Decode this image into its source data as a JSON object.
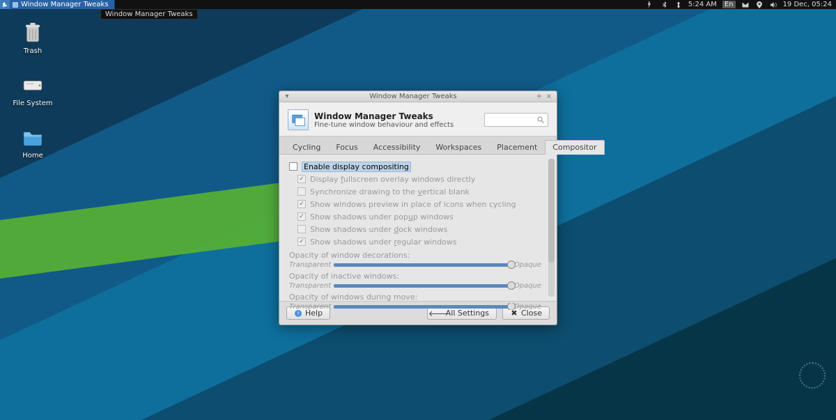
{
  "panel": {
    "task_label": "Window Manager Tweaks",
    "tooltip": "Window Manager Tweaks",
    "time": "5:24 AM",
    "lang": "En",
    "date": "19 Dec, 05:24"
  },
  "desktop": {
    "trash": "Trash",
    "filesystem": "File System",
    "home": "Home"
  },
  "dialog": {
    "title": "Window Manager Tweaks",
    "header_title": "Window Manager Tweaks",
    "header_subtitle": "Fine-tune window behaviour and effects",
    "tabs": [
      "Cycling",
      "Focus",
      "Accessibility",
      "Workspaces",
      "Placement",
      "Compositor"
    ],
    "opts": {
      "enable": "Enable display compositing",
      "full_pre": "Display ",
      "full_u": "f",
      "full_post": "ullscreen overlay windows directly",
      "sync_pre": "Synchronize drawing to the ",
      "sync_u": "v",
      "sync_post": "ertical blank",
      "prev": "Show windows preview in place of icons when cycling",
      "popup_pre": "Show shadows under pop",
      "popup_u": "u",
      "popup_post": "p windows",
      "dock_pre": "Show shadows under ",
      "dock_u": "d",
      "dock_post": "ock windows",
      "regular_pre": "Show shadows under ",
      "regular_u": "r",
      "regular_post": "egular windows"
    },
    "sections": {
      "deco": "Opacity of window decorations:",
      "inactive_pre": "Opacity of ",
      "inactive_u": "i",
      "inactive_post": "nactive windows:",
      "move": "Opacity of windows during move:"
    },
    "slider": {
      "min": "Transparent",
      "max": "Opaque"
    },
    "footer": {
      "help": "Help",
      "all": "All Settings",
      "close": "Close"
    }
  }
}
